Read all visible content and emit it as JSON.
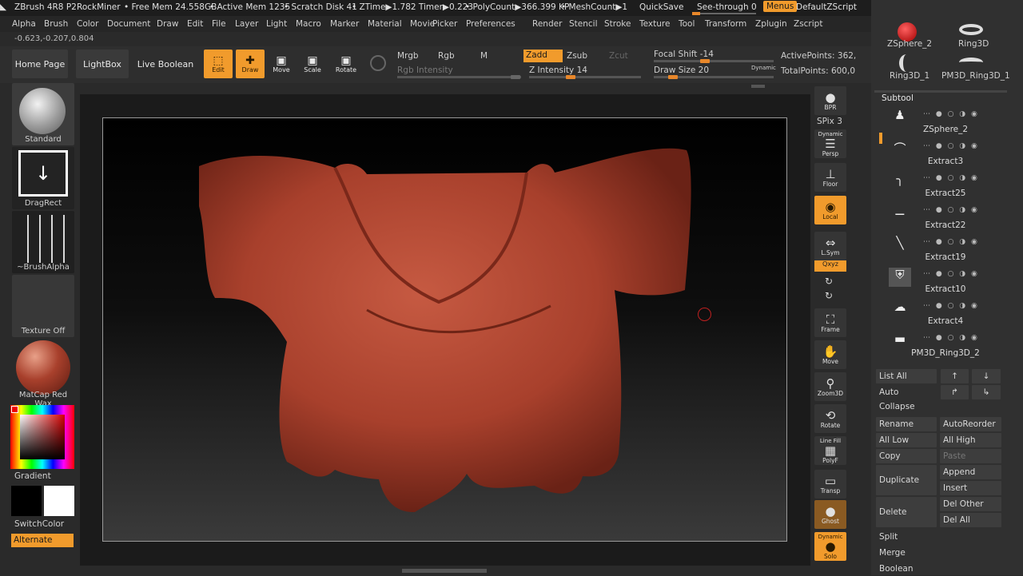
{
  "titlebar": {
    "app": "ZBrush 4R8 P2",
    "user": "RockMiner",
    "free_mem": "• Free Mem 24.558GB",
    "active_mem": "• Active Mem 1235",
    "scratch": "• Scratch Disk 41",
    "ztime": "• ZTime▶1.782 Timer▶0.223",
    "polycount": "• PolyCount▶366.399 KP",
    "meshcount": "• MeshCount▶1",
    "quicksave": "QuickSave",
    "seethrough": "See-through 0",
    "menus": "Menus",
    "script": "DefaultZScript"
  },
  "menus": [
    "Alpha",
    "Brush",
    "Color",
    "Document",
    "Draw",
    "Edit",
    "File",
    "Layer",
    "Light",
    "Macro",
    "Marker",
    "Material",
    "Movie",
    "Picker",
    "Preferences",
    "Render",
    "Stencil",
    "Stroke",
    "Texture",
    "Tool",
    "Transform",
    "Zplugin",
    "Zscript"
  ],
  "coords": "-0.623,-0.207,0.804",
  "shelf": {
    "home": "Home Page",
    "lightbox": "LightBox",
    "liveboolean": "Live Boolean",
    "edit": "Edit",
    "draw": "Draw",
    "move": "Move",
    "scale": "Scale",
    "rotate": "Rotate",
    "mrgb": "Mrgb",
    "rgb": "Rgb",
    "m": "M",
    "zadd": "Zadd",
    "zsub": "Zsub",
    "zcut": "Zcut",
    "rgb_intensity": "Rgb Intensity",
    "z_intensity": "Z Intensity 14",
    "focal_shift": "Focal Shift -14",
    "draw_size": "Draw Size 20",
    "dynamic": "Dynamic",
    "active_points": "ActivePoints: 362,",
    "total_points": "TotalPoints: 600,0"
  },
  "left": {
    "brush": "Standard",
    "stroke": "DragRect",
    "alpha": "~BrushAlpha",
    "texture": "Texture Off",
    "material": "MatCap Red Wax",
    "gradient": "Gradient",
    "switchcolor": "SwitchColor",
    "alternate": "Alternate"
  },
  "right": {
    "bpr": "BPR",
    "spix": "SPix 3",
    "persp": "Persp",
    "persp_top": "Dynamic",
    "floor": "Floor",
    "local": "Local",
    "lsym": "L.Sym",
    "xyz": "Qxyz",
    "frame": "Frame",
    "move": "Move",
    "zoom": "Zoom3D",
    "rotate": "Rotate",
    "polyf": "PolyF",
    "polyf_top": "Line Fill",
    "transp": "Transp",
    "ghost": "Ghost",
    "solo": "Solo",
    "solo_top": "Dynamic"
  },
  "tray": {
    "tools": [
      "ZSphere_2",
      "Ring3D",
      "Ring3D_1",
      "PM3D_Ring3D_1"
    ],
    "subtool_title": "Subtool",
    "subtools": [
      "ZSphere_2",
      "Extract3",
      "Extract25",
      "Extract22",
      "Extract19",
      "Extract10",
      "Extract4",
      "PM3D_Ring3D_2"
    ],
    "list_all": "List All",
    "auto_collapse": "Auto Collapse",
    "rename": "Rename",
    "autoreorder": "AutoReorder",
    "all_low": "All Low",
    "all_high": "All High",
    "copy": "Copy",
    "paste": "Paste",
    "duplicate": "Duplicate",
    "append": "Append",
    "insert": "Insert",
    "delete": "Delete",
    "del_other": "Del Other",
    "del_all": "Del All",
    "split": "Split",
    "merge": "Merge",
    "boolean": "Boolean"
  },
  "colors": {
    "accent": "#f19b2c",
    "mesh": "#a8402c",
    "background": "#2a2a2a"
  }
}
